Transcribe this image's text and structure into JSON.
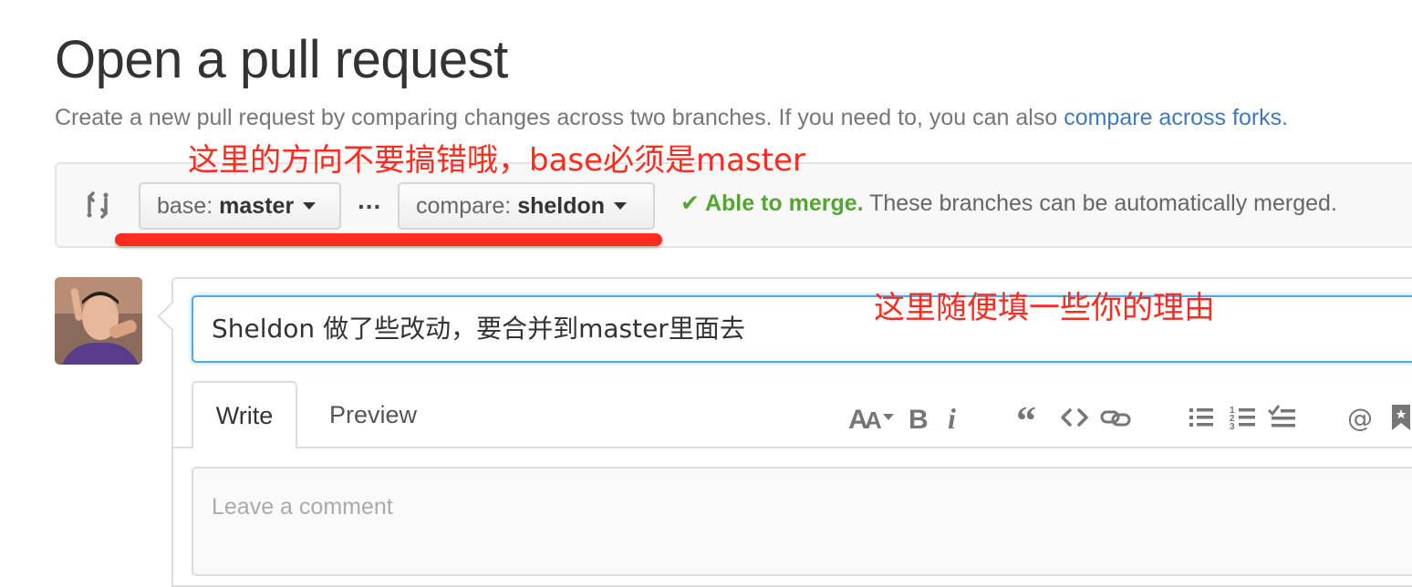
{
  "page": {
    "title": "Open a pull request",
    "subtitle": "Create a new pull request by comparing changes across two branches. If you need to, you can also ",
    "subtitle_link": "compare across forks."
  },
  "compare": {
    "base_prefix": "base:",
    "base_branch": "master",
    "separator": "...",
    "compare_prefix": "compare:",
    "compare_branch": "sheldon",
    "merge_ok": "Able to merge.",
    "merge_text": " These branches can be automatically merged."
  },
  "annotations": {
    "note_direction": "这里的方向不要搞错哦，base必须是master",
    "note_title": "这里随便填一些你的理由"
  },
  "form": {
    "title_value": "Sheldon 做了些改动，要合并到master里面去",
    "tabs": [
      {
        "label": "Write"
      },
      {
        "label": "Preview"
      }
    ],
    "comment_placeholder": "Leave a comment"
  },
  "toolbar": {
    "icons": [
      "text-size-icon",
      "bold-icon",
      "italic-icon",
      "quote-icon",
      "code-icon",
      "link-icon",
      "unordered-list-icon",
      "ordered-list-icon",
      "task-list-icon",
      "mention-icon",
      "saved-reply-icon"
    ]
  },
  "colors": {
    "link": "#4078c0",
    "merge_ok": "#55a532",
    "annotation": "#ff2b1f",
    "focus": "#51a7e8"
  }
}
